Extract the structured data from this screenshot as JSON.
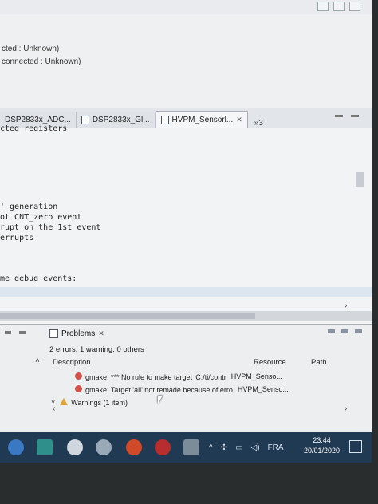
{
  "debug": {
    "lines": [
      "cted : Unknown)",
      "connected : Unknown)"
    ]
  },
  "tabs": [
    {
      "label": "DSP2833x_ADC..."
    },
    {
      "label": "DSP2833x_Gl..."
    },
    {
      "label": "HVPM_Sensorl..."
    }
  ],
  "tab_overflow": "»3",
  "editor": {
    "lines": [
      "cted registers",
      "' generation",
      "ot CNT_zero event",
      "rupt on the 1st event",
      "errupts",
      "me debug events:"
    ]
  },
  "problems": {
    "title": "Problems",
    "summary": "2 errors, 1 warning, 0 others",
    "columns": {
      "description": "Description",
      "resource": "Resource",
      "path": "Path"
    },
    "rows": [
      {
        "type": "error",
        "description": "gmake: *** No rule to make target 'C:/ti/contr",
        "resource": "HVPM_Senso..."
      },
      {
        "type": "error",
        "description": "gmake: Target 'all' not remade because of erro",
        "resource": "HVPM_Senso..."
      },
      {
        "type": "warning",
        "description": "Warnings (1 item)",
        "resource": ""
      }
    ]
  },
  "taskbar": {
    "language": "FRA",
    "time": "23:44",
    "date": "20/01/2020"
  },
  "colors": {
    "error": "#d0534a",
    "warning": "#e0a52e",
    "taskbar": "#1f3a52"
  }
}
